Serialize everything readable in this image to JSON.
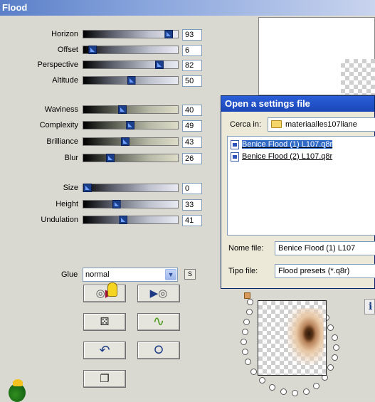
{
  "window": {
    "title": "Flood"
  },
  "sliders": [
    {
      "label": "Horizon",
      "value": "93",
      "fraction": 0.93
    },
    {
      "label": "Offset",
      "value": "6",
      "fraction": 0.06
    },
    {
      "label": "Perspective",
      "value": "82",
      "fraction": 0.82
    },
    {
      "label": "Altitude",
      "value": "50",
      "fraction": 0.5
    },
    {
      "label": "Waviness",
      "value": "40",
      "fraction": 0.4
    },
    {
      "label": "Complexity",
      "value": "49",
      "fraction": 0.49
    },
    {
      "label": "Brilliance",
      "value": "43",
      "fraction": 0.43
    },
    {
      "label": "Blur",
      "value": "26",
      "fraction": 0.26
    },
    {
      "label": "Size",
      "value": "0",
      "fraction": 0.0
    },
    {
      "label": "Height",
      "value": "33",
      "fraction": 0.33
    },
    {
      "label": "Undulation",
      "value": "41",
      "fraction": 0.41
    }
  ],
  "glue": {
    "label": "Glue",
    "value": "normal",
    "toggle_label": "S"
  },
  "buttons": {
    "load_preset_icon": "load-settings-icon",
    "save_preset_icon": "save-settings-icon",
    "randomize_icon": "dice-icon",
    "wave_icon": "wave-icon",
    "undo_icon": "undo-icon",
    "reset_icon": "reset-icon",
    "copy_icon": "copy-icon"
  },
  "dialog": {
    "title": "Open a settings file",
    "look_in_label": "Cerca in:",
    "look_in_value": "materiaalles107liane",
    "files": [
      "Benice Flood (1)  L107.q8r",
      "Benice Flood (2) L107.q8r"
    ],
    "filename_label": "Nome file:",
    "filename_value": "Benice Flood (1)  L107",
    "filetype_label": "Tipo file:",
    "filetype_value": "Flood presets (*.q8r)"
  },
  "info_button": {
    "label": "i"
  },
  "colors": {
    "selection": "#316ac5",
    "dialog_title": "#2a5fd8",
    "window_title": "#5a7fc8"
  }
}
